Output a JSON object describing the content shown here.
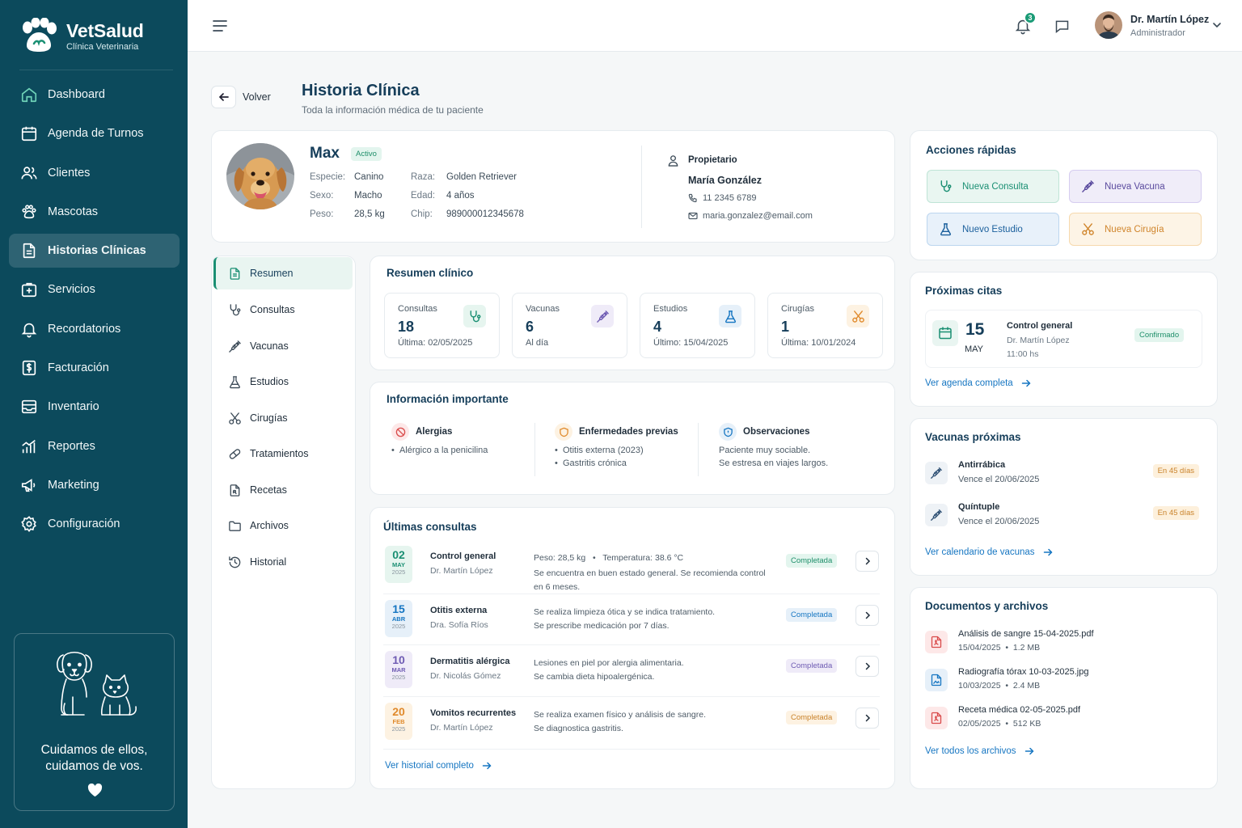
{
  "brand": {
    "name": "VetSalud",
    "subtitle": "Clínica Veterinaria"
  },
  "sidebar": {
    "items": [
      {
        "label": "Dashboard",
        "icon": "home-icon"
      },
      {
        "label": "Agenda de Turnos",
        "icon": "calendar-icon"
      },
      {
        "label": "Clientes",
        "icon": "users-icon"
      },
      {
        "label": "Mascotas",
        "icon": "paw-icon"
      },
      {
        "label": "Historias Clínicas",
        "icon": "file-icon",
        "active": true
      },
      {
        "label": "Servicios",
        "icon": "medical-box-icon"
      },
      {
        "label": "Recordatorios",
        "icon": "bell-icon"
      },
      {
        "label": "Facturación",
        "icon": "dollar-icon"
      },
      {
        "label": "Inventario",
        "icon": "archive-icon"
      },
      {
        "label": "Reportes",
        "icon": "chart-icon"
      },
      {
        "label": "Marketing",
        "icon": "megaphone-icon"
      },
      {
        "label": "Configuración",
        "icon": "gear-icon"
      }
    ],
    "promo": {
      "line1": "Cuidamos de ellos,",
      "line2": "cuidamos de vos."
    }
  },
  "topbar": {
    "notifications_count": "3",
    "user": {
      "name": "Dr. Martín López",
      "role": "Administrador"
    }
  },
  "header": {
    "back_label": "Volver",
    "title": "Historia Clínica",
    "subtitle": "Toda la información médica de tu paciente"
  },
  "patient": {
    "name": "Max",
    "status": "Activo",
    "fields": {
      "especie_label": "Especie:",
      "especie": "Canino",
      "sexo_label": "Sexo:",
      "sexo": "Macho",
      "peso_label": "Peso:",
      "peso": "28,5 kg",
      "raza_label": "Raza:",
      "raza": "Golden Retriever",
      "edad_label": "Edad:",
      "edad": "4 años",
      "chip_label": "Chip:",
      "chip": "989000012345678"
    },
    "owner": {
      "label": "Propietario",
      "name": "María González",
      "phone": "11 2345 6789",
      "email": "maria.gonzalez@email.com"
    }
  },
  "subnav": [
    {
      "label": "Resumen",
      "icon": "file-icon",
      "active": true
    },
    {
      "label": "Consultas",
      "icon": "stethoscope-icon"
    },
    {
      "label": "Vacunas",
      "icon": "syringe-icon"
    },
    {
      "label": "Estudios",
      "icon": "flask-icon"
    },
    {
      "label": "Cirugías",
      "icon": "scissors-icon"
    },
    {
      "label": "Tratamientos",
      "icon": "pill-icon"
    },
    {
      "label": "Recetas",
      "icon": "prescription-icon"
    },
    {
      "label": "Archivos",
      "icon": "folder-icon"
    },
    {
      "label": "Historial",
      "icon": "history-icon"
    }
  ],
  "summary": {
    "title": "Resumen clínico",
    "stats": [
      {
        "label": "Consultas",
        "value": "18",
        "sub": "Última: 02/05/2025",
        "icon": "stethoscope-icon",
        "color": "#1a8f73"
      },
      {
        "label": "Vacunas",
        "value": "6",
        "sub": "Al día",
        "icon": "syringe-icon",
        "color": "#6e5bb3"
      },
      {
        "label": "Estudios",
        "value": "4",
        "sub": "Último: 15/04/2025",
        "icon": "flask-icon",
        "color": "#1676c2"
      },
      {
        "label": "Cirugías",
        "value": "1",
        "sub": "Última: 10/01/2024",
        "icon": "scissors-icon",
        "color": "#e08a2c"
      }
    ]
  },
  "important": {
    "title": "Información importante",
    "allergies": {
      "title": "Alergias",
      "items": [
        "Alérgico a la penicilina"
      ]
    },
    "diseases": {
      "title": "Enfermedades previas",
      "items": [
        "Otitis externa (2023)",
        "Gastritis crónica"
      ]
    },
    "notes": {
      "title": "Observaciones",
      "lines": [
        "Paciente muy sociable.",
        "Se estresa en viajes largos."
      ]
    }
  },
  "consultations": {
    "title": "Últimas consultas",
    "rows": [
      {
        "day": "02",
        "month": "MAY",
        "year": "2025",
        "title": "Control general",
        "doctor": "Dr. Martín López",
        "line1": "Peso: 28,5 kg   •   Temperatura: 38.6 °C",
        "line2": "Se encuentra en buen estado general. Se recomienda control en 6 meses.",
        "status": "Completada",
        "color": "#1a8f73"
      },
      {
        "day": "15",
        "month": "ABR",
        "year": "2025",
        "title": "Otitis externa",
        "doctor": "Dra. Sofía Ríos",
        "line1": "Se realiza limpieza ótica y se indica tratamiento.",
        "line2": "Se prescribe medicación por 7 días.",
        "status": "Completada",
        "color": "#1676c2"
      },
      {
        "day": "10",
        "month": "MAR",
        "year": "2025",
        "title": "Dermatitis alérgica",
        "doctor": "Dr. Nicolás Gómez",
        "line1": "Lesiones en piel por alergia alimentaria.",
        "line2": "Se cambia dieta hipoalergénica.",
        "status": "Completada",
        "color": "#6e5bb3"
      },
      {
        "day": "20",
        "month": "FEB",
        "year": "2025",
        "title": "Vomitos recurrentes",
        "doctor": "Dr. Martín López",
        "line1": "Se realiza examen físico y análisis de sangre.",
        "line2": "Se diagnostica gastritis.",
        "status": "Completada",
        "color": "#e08a2c"
      }
    ],
    "link": "Ver historial completo"
  },
  "quick_actions": {
    "title": "Acciones rápidas",
    "buttons": [
      {
        "label": "Nueva Consulta",
        "icon": "stethoscope-icon"
      },
      {
        "label": "Nueva Vacuna",
        "icon": "syringe-icon"
      },
      {
        "label": "Nuevo Estudio",
        "icon": "flask-icon"
      },
      {
        "label": "Nueva Cirugía",
        "icon": "scissors-icon"
      }
    ]
  },
  "appointments": {
    "title": "Próximas citas",
    "item": {
      "day": "15",
      "month": "MAY",
      "title": "Control general",
      "doctor": "Dr. Martín López",
      "time": "11:00 hs",
      "status": "Confirmado"
    },
    "link": "Ver agenda completa"
  },
  "vaccines": {
    "title": "Vacunas próximas",
    "items": [
      {
        "name": "Antirrábica",
        "due": "Vence el 20/06/2025",
        "badge": "En 45 días"
      },
      {
        "name": "Quíntuple",
        "due": "Vence el 20/06/2025",
        "badge": "En 45 días"
      }
    ],
    "link": "Ver calendario de vacunas"
  },
  "documents": {
    "title": "Documentos y archivos",
    "items": [
      {
        "name": "Análisis de sangre 15-04-2025.pdf",
        "date": "15/04/2025",
        "size": "1.2 MB",
        "icon": "pdf-icon"
      },
      {
        "name": "Radiografía tórax 10-03-2025.jpg",
        "date": "10/03/2025",
        "size": "2.4 MB",
        "icon": "image-file-icon"
      },
      {
        "name": "Receta médica 02-05-2025.pdf",
        "date": "02/05/2025",
        "size": "512 KB",
        "icon": "pdf-icon"
      }
    ],
    "link": "Ver todos los archivos"
  }
}
